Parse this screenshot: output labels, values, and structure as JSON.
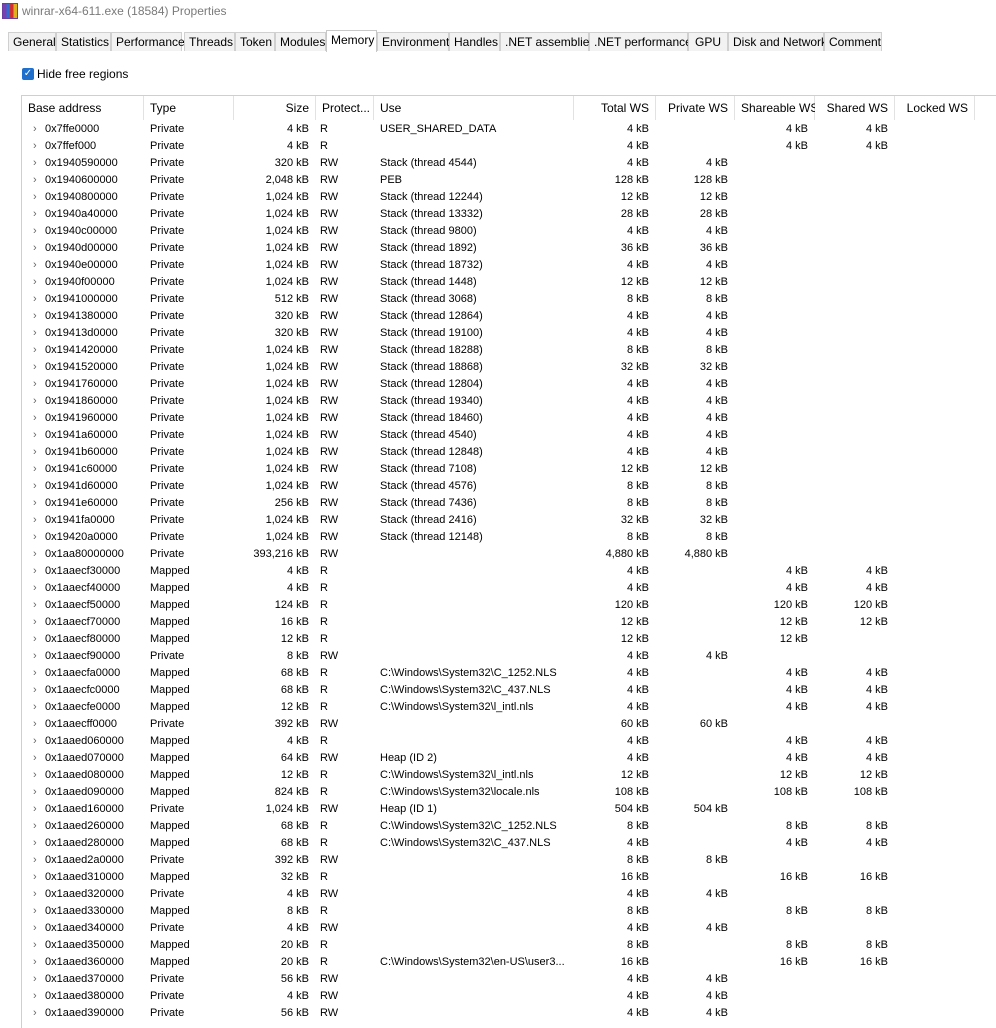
{
  "window": {
    "title": "winrar-x64-611.exe (18584) Properties"
  },
  "tabs": [
    "General",
    "Statistics",
    "Performance",
    "Threads",
    "Token",
    "Modules",
    "Memory",
    "Environment",
    "Handles",
    ".NET assemblies",
    ".NET performance",
    "GPU",
    "Disk and Network",
    "Comment"
  ],
  "active_tab": "Memory",
  "options": {
    "hide_free_regions": "Hide free regions"
  },
  "columns": [
    "Base address",
    "Type",
    "Size",
    "Protect...",
    "Use",
    "Total WS",
    "Private WS",
    "Shareable WS",
    "Shared WS",
    "Locked WS"
  ],
  "rows": [
    [
      "0x7ffe0000",
      "Private",
      "4 kB",
      "R",
      "USER_SHARED_DATA",
      "4 kB",
      "",
      "4 kB",
      "4 kB",
      ""
    ],
    [
      "0x7ffef000",
      "Private",
      "4 kB",
      "R",
      "",
      "4 kB",
      "",
      "4 kB",
      "4 kB",
      ""
    ],
    [
      "0x1940590000",
      "Private",
      "320 kB",
      "RW",
      "Stack (thread 4544)",
      "4 kB",
      "4 kB",
      "",
      "",
      ""
    ],
    [
      "0x1940600000",
      "Private",
      "2,048 kB",
      "RW",
      "PEB",
      "128 kB",
      "128 kB",
      "",
      "",
      ""
    ],
    [
      "0x1940800000",
      "Private",
      "1,024 kB",
      "RW",
      "Stack (thread 12244)",
      "12 kB",
      "12 kB",
      "",
      "",
      ""
    ],
    [
      "0x1940a40000",
      "Private",
      "1,024 kB",
      "RW",
      "Stack (thread 13332)",
      "28 kB",
      "28 kB",
      "",
      "",
      ""
    ],
    [
      "0x1940c00000",
      "Private",
      "1,024 kB",
      "RW",
      "Stack (thread 9800)",
      "4 kB",
      "4 kB",
      "",
      "",
      ""
    ],
    [
      "0x1940d00000",
      "Private",
      "1,024 kB",
      "RW",
      "Stack (thread 1892)",
      "36 kB",
      "36 kB",
      "",
      "",
      ""
    ],
    [
      "0x1940e00000",
      "Private",
      "1,024 kB",
      "RW",
      "Stack (thread 18732)",
      "4 kB",
      "4 kB",
      "",
      "",
      ""
    ],
    [
      "0x1940f00000",
      "Private",
      "1,024 kB",
      "RW",
      "Stack (thread 1448)",
      "12 kB",
      "12 kB",
      "",
      "",
      ""
    ],
    [
      "0x1941000000",
      "Private",
      "512 kB",
      "RW",
      "Stack (thread 3068)",
      "8 kB",
      "8 kB",
      "",
      "",
      ""
    ],
    [
      "0x1941380000",
      "Private",
      "320 kB",
      "RW",
      "Stack (thread 12864)",
      "4 kB",
      "4 kB",
      "",
      "",
      ""
    ],
    [
      "0x19413d0000",
      "Private",
      "320 kB",
      "RW",
      "Stack (thread 19100)",
      "4 kB",
      "4 kB",
      "",
      "",
      ""
    ],
    [
      "0x1941420000",
      "Private",
      "1,024 kB",
      "RW",
      "Stack (thread 18288)",
      "8 kB",
      "8 kB",
      "",
      "",
      ""
    ],
    [
      "0x1941520000",
      "Private",
      "1,024 kB",
      "RW",
      "Stack (thread 18868)",
      "32 kB",
      "32 kB",
      "",
      "",
      ""
    ],
    [
      "0x1941760000",
      "Private",
      "1,024 kB",
      "RW",
      "Stack (thread 12804)",
      "4 kB",
      "4 kB",
      "",
      "",
      ""
    ],
    [
      "0x1941860000",
      "Private",
      "1,024 kB",
      "RW",
      "Stack (thread 19340)",
      "4 kB",
      "4 kB",
      "",
      "",
      ""
    ],
    [
      "0x1941960000",
      "Private",
      "1,024 kB",
      "RW",
      "Stack (thread 18460)",
      "4 kB",
      "4 kB",
      "",
      "",
      ""
    ],
    [
      "0x1941a60000",
      "Private",
      "1,024 kB",
      "RW",
      "Stack (thread 4540)",
      "4 kB",
      "4 kB",
      "",
      "",
      ""
    ],
    [
      "0x1941b60000",
      "Private",
      "1,024 kB",
      "RW",
      "Stack (thread 12848)",
      "4 kB",
      "4 kB",
      "",
      "",
      ""
    ],
    [
      "0x1941c60000",
      "Private",
      "1,024 kB",
      "RW",
      "Stack (thread 7108)",
      "12 kB",
      "12 kB",
      "",
      "",
      ""
    ],
    [
      "0x1941d60000",
      "Private",
      "1,024 kB",
      "RW",
      "Stack (thread 4576)",
      "8 kB",
      "8 kB",
      "",
      "",
      ""
    ],
    [
      "0x1941e60000",
      "Private",
      "256 kB",
      "RW",
      "Stack (thread 7436)",
      "8 kB",
      "8 kB",
      "",
      "",
      ""
    ],
    [
      "0x1941fa0000",
      "Private",
      "1,024 kB",
      "RW",
      "Stack (thread 2416)",
      "32 kB",
      "32 kB",
      "",
      "",
      ""
    ],
    [
      "0x19420a0000",
      "Private",
      "1,024 kB",
      "RW",
      "Stack (thread 12148)",
      "8 kB",
      "8 kB",
      "",
      "",
      ""
    ],
    [
      "0x1aa80000000",
      "Private",
      "393,216 kB",
      "RW",
      "",
      "4,880 kB",
      "4,880 kB",
      "",
      "",
      ""
    ],
    [
      "0x1aaecf30000",
      "Mapped",
      "4 kB",
      "R",
      "",
      "4 kB",
      "",
      "4 kB",
      "4 kB",
      ""
    ],
    [
      "0x1aaecf40000",
      "Mapped",
      "4 kB",
      "R",
      "",
      "4 kB",
      "",
      "4 kB",
      "4 kB",
      ""
    ],
    [
      "0x1aaecf50000",
      "Mapped",
      "124 kB",
      "R",
      "",
      "120 kB",
      "",
      "120 kB",
      "120 kB",
      ""
    ],
    [
      "0x1aaecf70000",
      "Mapped",
      "16 kB",
      "R",
      "",
      "12 kB",
      "",
      "12 kB",
      "12 kB",
      ""
    ],
    [
      "0x1aaecf80000",
      "Mapped",
      "12 kB",
      "R",
      "",
      "12 kB",
      "",
      "12 kB",
      "",
      ""
    ],
    [
      "0x1aaecf90000",
      "Private",
      "8 kB",
      "RW",
      "",
      "4 kB",
      "4 kB",
      "",
      "",
      ""
    ],
    [
      "0x1aaecfa0000",
      "Mapped",
      "68 kB",
      "R",
      "C:\\Windows\\System32\\C_1252.NLS",
      "4 kB",
      "",
      "4 kB",
      "4 kB",
      ""
    ],
    [
      "0x1aaecfc0000",
      "Mapped",
      "68 kB",
      "R",
      "C:\\Windows\\System32\\C_437.NLS",
      "4 kB",
      "",
      "4 kB",
      "4 kB",
      ""
    ],
    [
      "0x1aaecfe0000",
      "Mapped",
      "12 kB",
      "R",
      "C:\\Windows\\System32\\l_intl.nls",
      "4 kB",
      "",
      "4 kB",
      "4 kB",
      ""
    ],
    [
      "0x1aaecff0000",
      "Private",
      "392 kB",
      "RW",
      "",
      "60 kB",
      "60 kB",
      "",
      "",
      ""
    ],
    [
      "0x1aaed060000",
      "Mapped",
      "4 kB",
      "R",
      "",
      "4 kB",
      "",
      "4 kB",
      "4 kB",
      ""
    ],
    [
      "0x1aaed070000",
      "Mapped",
      "64 kB",
      "RW",
      "Heap (ID 2)",
      "4 kB",
      "",
      "4 kB",
      "4 kB",
      ""
    ],
    [
      "0x1aaed080000",
      "Mapped",
      "12 kB",
      "R",
      "C:\\Windows\\System32\\l_intl.nls",
      "12 kB",
      "",
      "12 kB",
      "12 kB",
      ""
    ],
    [
      "0x1aaed090000",
      "Mapped",
      "824 kB",
      "R",
      "C:\\Windows\\System32\\locale.nls",
      "108 kB",
      "",
      "108 kB",
      "108 kB",
      ""
    ],
    [
      "0x1aaed160000",
      "Private",
      "1,024 kB",
      "RW",
      "Heap (ID 1)",
      "504 kB",
      "504 kB",
      "",
      "",
      ""
    ],
    [
      "0x1aaed260000",
      "Mapped",
      "68 kB",
      "R",
      "C:\\Windows\\System32\\C_1252.NLS",
      "8 kB",
      "",
      "8 kB",
      "8 kB",
      ""
    ],
    [
      "0x1aaed280000",
      "Mapped",
      "68 kB",
      "R",
      "C:\\Windows\\System32\\C_437.NLS",
      "4 kB",
      "",
      "4 kB",
      "4 kB",
      ""
    ],
    [
      "0x1aaed2a0000",
      "Private",
      "392 kB",
      "RW",
      "",
      "8 kB",
      "8 kB",
      "",
      "",
      ""
    ],
    [
      "0x1aaed310000",
      "Mapped",
      "32 kB",
      "R",
      "",
      "16 kB",
      "",
      "16 kB",
      "16 kB",
      ""
    ],
    [
      "0x1aaed320000",
      "Private",
      "4 kB",
      "RW",
      "",
      "4 kB",
      "4 kB",
      "",
      "",
      ""
    ],
    [
      "0x1aaed330000",
      "Mapped",
      "8 kB",
      "R",
      "",
      "8 kB",
      "",
      "8 kB",
      "8 kB",
      ""
    ],
    [
      "0x1aaed340000",
      "Private",
      "4 kB",
      "RW",
      "",
      "4 kB",
      "4 kB",
      "",
      "",
      ""
    ],
    [
      "0x1aaed350000",
      "Mapped",
      "20 kB",
      "R",
      "",
      "8 kB",
      "",
      "8 kB",
      "8 kB",
      ""
    ],
    [
      "0x1aaed360000",
      "Mapped",
      "20 kB",
      "R",
      "C:\\Windows\\System32\\en-US\\user3...",
      "16 kB",
      "",
      "16 kB",
      "16 kB",
      ""
    ],
    [
      "0x1aaed370000",
      "Private",
      "56 kB",
      "RW",
      "",
      "4 kB",
      "4 kB",
      "",
      "",
      ""
    ],
    [
      "0x1aaed380000",
      "Private",
      "4 kB",
      "RW",
      "",
      "4 kB",
      "4 kB",
      "",
      "",
      ""
    ],
    [
      "0x1aaed390000",
      "Private",
      "56 kB",
      "RW",
      "",
      "4 kB",
      "4 kB",
      "",
      "",
      ""
    ]
  ]
}
